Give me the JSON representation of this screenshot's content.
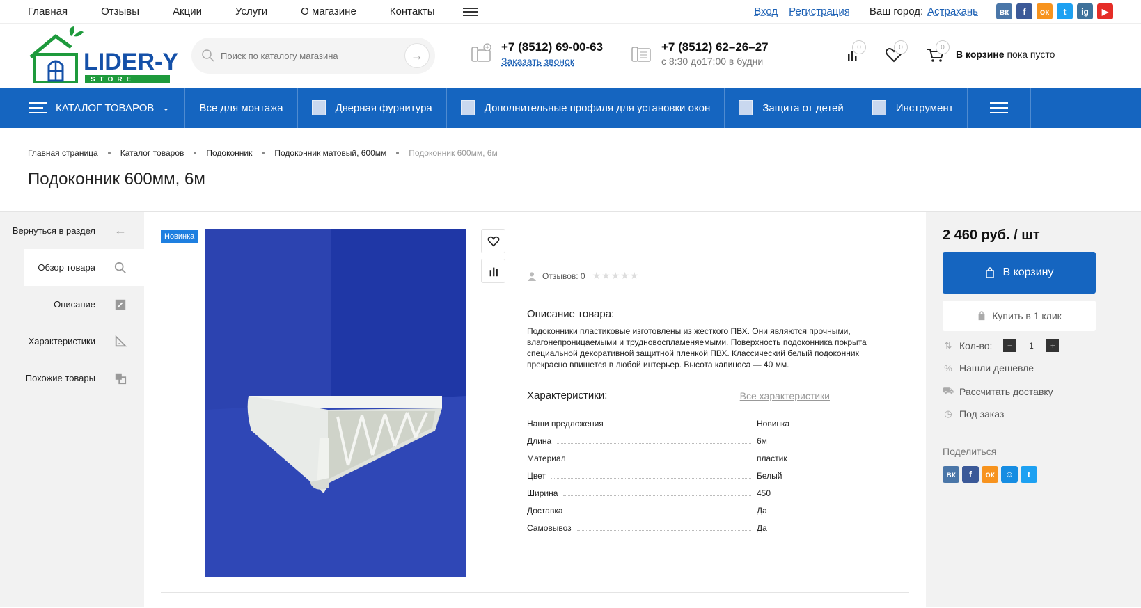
{
  "topnav": {
    "items": [
      "Главная",
      "Отзывы",
      "Акции",
      "Услуги",
      "О магазине",
      "Контакты"
    ],
    "login": "Вход",
    "register": "Регистрация",
    "city_label": "Ваш город:",
    "city": "Астрахань",
    "socials": [
      {
        "icon": "vk-icon",
        "glyph": "вк",
        "color": "#4a76a8"
      },
      {
        "icon": "facebook-icon",
        "glyph": "f",
        "color": "#3b5998"
      },
      {
        "icon": "odnoklassniki-icon",
        "glyph": "ок",
        "color": "#f7931e"
      },
      {
        "icon": "twitter-icon",
        "glyph": "t",
        "color": "#1da1f2"
      },
      {
        "icon": "instagram-icon",
        "glyph": "ig",
        "color": "#3f729b"
      },
      {
        "icon": "youtube-icon",
        "glyph": "▶",
        "color": "#e52d27"
      }
    ]
  },
  "header": {
    "logo_text": "LIDER-YG",
    "logo_sub": "STORE",
    "search_placeholder": "Поиск по каталогу магазина",
    "phone1": "+7 (8512) 69-00-63",
    "phone1_sub": "Заказать звонок",
    "phone2": "+7 (8512) 62–26–27",
    "phone2_sub": "с 8:30 до17:00 в будни",
    "compare_count": "0",
    "favorites_count": "0",
    "cart_count": "0",
    "cart_label": "В корзине",
    "cart_status": "пока пусто"
  },
  "mainnav": {
    "catalog": "КАТАЛОГ ТОВАРОВ",
    "items": [
      "Все для монтажа",
      "Дверная фурнитура",
      "Дополнительные профиля для установки окон",
      "Защита от детей",
      "Инструмент"
    ]
  },
  "breadcrumbs": [
    "Главная страница",
    "Каталог товаров",
    "Подоконник",
    "Подоконник матовый, 600мм",
    "Подоконник 600мм, 6м"
  ],
  "page_title": "Подоконник 600мм, 6м",
  "leftnav": {
    "back": "Вернуться в раздел",
    "items": [
      "Обзор товара",
      "Описание",
      "Характеристики",
      "Похожие товары"
    ]
  },
  "product": {
    "badge": "Новинка",
    "reviews": "Отзывов: 0",
    "rating": 0,
    "desc_title": "Описание товара:",
    "desc_text": "Подоконники пластиковые изготовлены из жесткого ПВХ. Они являются прочными, влагонепроницаемыми и трудновоспламеняемыми. Поверхность подоконника покрыта специальной декоративной защитной пленкой ПВХ. Классический белый подоконник прекрасно впишется в любой интерьер. Высота капиноса — 40 мм.",
    "chars_title": "Характеристики:",
    "chars_all": "Все характеристики",
    "chars": [
      {
        "k": "Наши предложения",
        "v": "Новинка"
      },
      {
        "k": "Длина",
        "v": "6м"
      },
      {
        "k": "Материал",
        "v": "пластик"
      },
      {
        "k": "Цвет",
        "v": "Белый"
      },
      {
        "k": "Ширина",
        "v": "450"
      },
      {
        "k": "Доставка",
        "v": "Да"
      },
      {
        "k": "Самовывоз",
        "v": "Да"
      }
    ]
  },
  "buy": {
    "price": "2 460 руб. / шт",
    "to_cart": "В корзину",
    "one_click": "Купить в 1 клик",
    "qty_label": "Кол-во:",
    "qty": "1",
    "cheaper": "Нашли дешевле",
    "delivery": "Рассчитать доставку",
    "preorder": "Под заказ",
    "share_label": "Поделиться"
  },
  "colors": {
    "brand_blue": "#1565c0",
    "badge_blue": "#1e7fe0",
    "logo_green": "#1e9a3c",
    "logo_blue": "#1450a8"
  }
}
